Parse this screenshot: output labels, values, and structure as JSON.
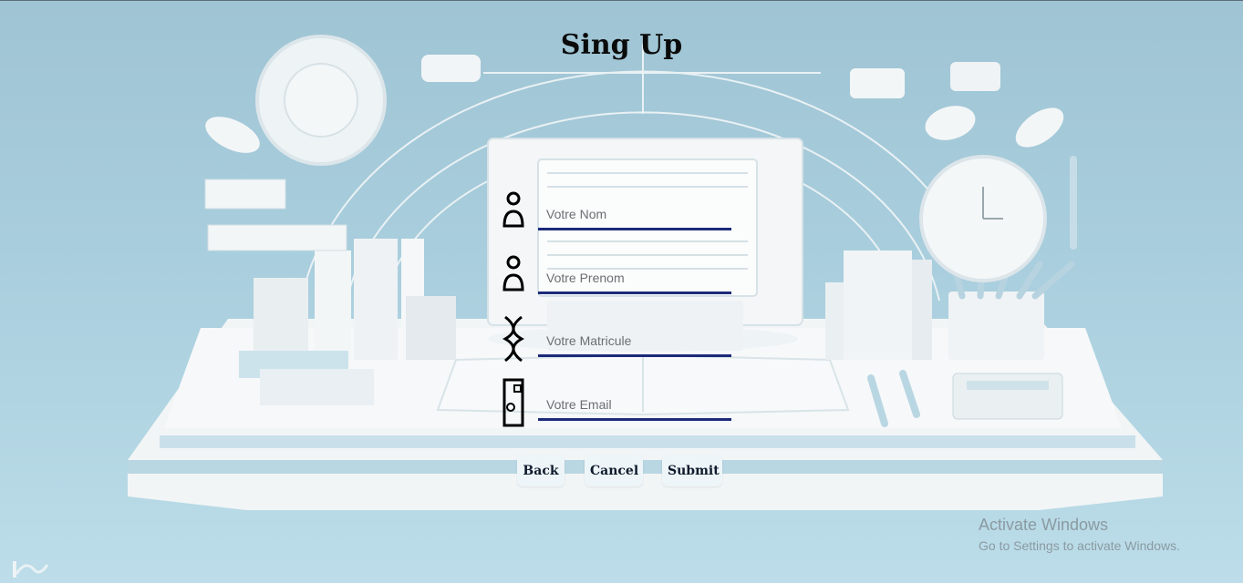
{
  "page": {
    "title": "Sing Up"
  },
  "form": {
    "fields": [
      {
        "name": "nom",
        "placeholder": "Votre Nom"
      },
      {
        "name": "prenom",
        "placeholder": "Votre Prenom"
      },
      {
        "name": "matricule",
        "placeholder": "Votre Matricule"
      },
      {
        "name": "email",
        "placeholder": "Votre Email"
      }
    ]
  },
  "buttons": {
    "back": "Back",
    "cancel": "Cancel",
    "submit": "Submit"
  },
  "watermark": {
    "line1": "Activate Windows",
    "line2": "Go to Settings to activate Windows."
  },
  "icons": [
    "person-icon",
    "person-icon",
    "dna-icon",
    "email-card-icon"
  ],
  "colors": {
    "underline": "#1c2b7a",
    "background": "#a9cedd"
  }
}
